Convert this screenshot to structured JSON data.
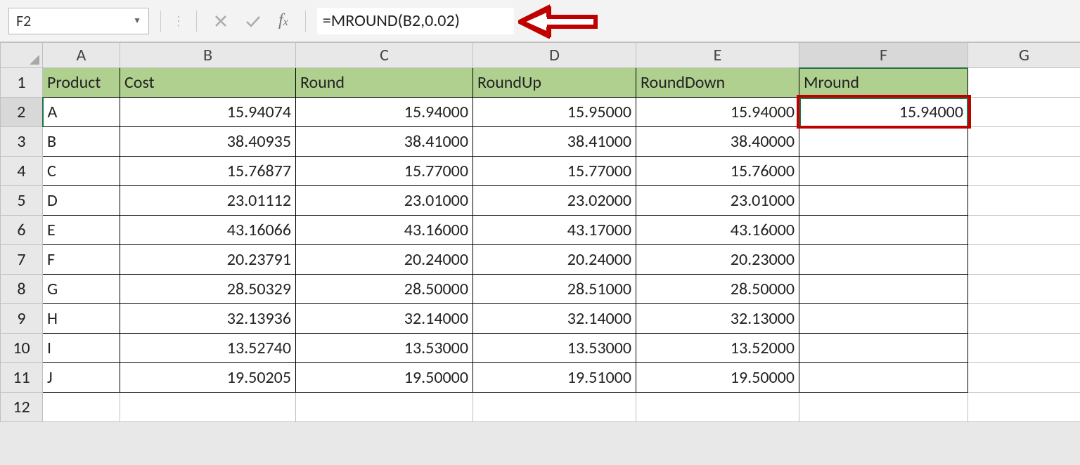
{
  "namebox": "F2",
  "formula": "=MROUND(B2,0.02)",
  "columns": [
    "A",
    "B",
    "C",
    "D",
    "E",
    "F",
    "G"
  ],
  "row_numbers": [
    "1",
    "2",
    "3",
    "4",
    "5",
    "6",
    "7",
    "8",
    "9",
    "10",
    "11",
    "12"
  ],
  "headers": {
    "A": "Product",
    "B": "Cost",
    "C": "Round",
    "D": "RoundUp",
    "E": "RoundDown",
    "F": "Mround"
  },
  "rows": [
    {
      "A": "A",
      "B": "15.94074",
      "C": "15.94000",
      "D": "15.95000",
      "E": "15.94000",
      "F": "15.94000"
    },
    {
      "A": "B",
      "B": "38.40935",
      "C": "38.41000",
      "D": "38.41000",
      "E": "38.40000",
      "F": ""
    },
    {
      "A": "C",
      "B": "15.76877",
      "C": "15.77000",
      "D": "15.77000",
      "E": "15.76000",
      "F": ""
    },
    {
      "A": "D",
      "B": "23.01112",
      "C": "23.01000",
      "D": "23.02000",
      "E": "23.01000",
      "F": ""
    },
    {
      "A": "E",
      "B": "43.16066",
      "C": "43.16000",
      "D": "43.17000",
      "E": "43.16000",
      "F": ""
    },
    {
      "A": "F",
      "B": "20.23791",
      "C": "20.24000",
      "D": "20.24000",
      "E": "20.23000",
      "F": ""
    },
    {
      "A": "G",
      "B": "28.50329",
      "C": "28.50000",
      "D": "28.51000",
      "E": "28.50000",
      "F": ""
    },
    {
      "A": "H",
      "B": "32.13936",
      "C": "32.14000",
      "D": "32.14000",
      "E": "32.13000",
      "F": ""
    },
    {
      "A": "I",
      "B": "13.52740",
      "C": "13.53000",
      "D": "13.53000",
      "E": "13.52000",
      "F": ""
    },
    {
      "A": "J",
      "B": "19.50205",
      "C": "19.50000",
      "D": "19.51000",
      "E": "19.50000",
      "F": ""
    }
  ],
  "annotation": {
    "arrow_color": "#c00000"
  },
  "chart_data": {
    "type": "table",
    "title": "Rounding functions comparison",
    "columns": [
      "Product",
      "Cost",
      "Round",
      "RoundUp",
      "RoundDown",
      "Mround"
    ],
    "data": [
      [
        "A",
        15.94074,
        15.94,
        15.95,
        15.94,
        15.94
      ],
      [
        "B",
        38.40935,
        38.41,
        38.41,
        38.4,
        null
      ],
      [
        "C",
        15.76877,
        15.77,
        15.77,
        15.76,
        null
      ],
      [
        "D",
        23.01112,
        23.01,
        23.02,
        23.01,
        null
      ],
      [
        "E",
        43.16066,
        43.16,
        43.17,
        43.16,
        null
      ],
      [
        "F",
        20.23791,
        20.24,
        20.24,
        20.23,
        null
      ],
      [
        "G",
        28.50329,
        28.5,
        28.51,
        28.5,
        null
      ],
      [
        "H",
        32.13936,
        32.14,
        32.14,
        32.13,
        null
      ],
      [
        "I",
        13.5274,
        13.53,
        13.53,
        13.52,
        null
      ],
      [
        "J",
        19.50205,
        19.5,
        19.51,
        19.5,
        null
      ]
    ],
    "formula_shown": "=MROUND(B2,0.02)",
    "active_cell": "F2"
  }
}
